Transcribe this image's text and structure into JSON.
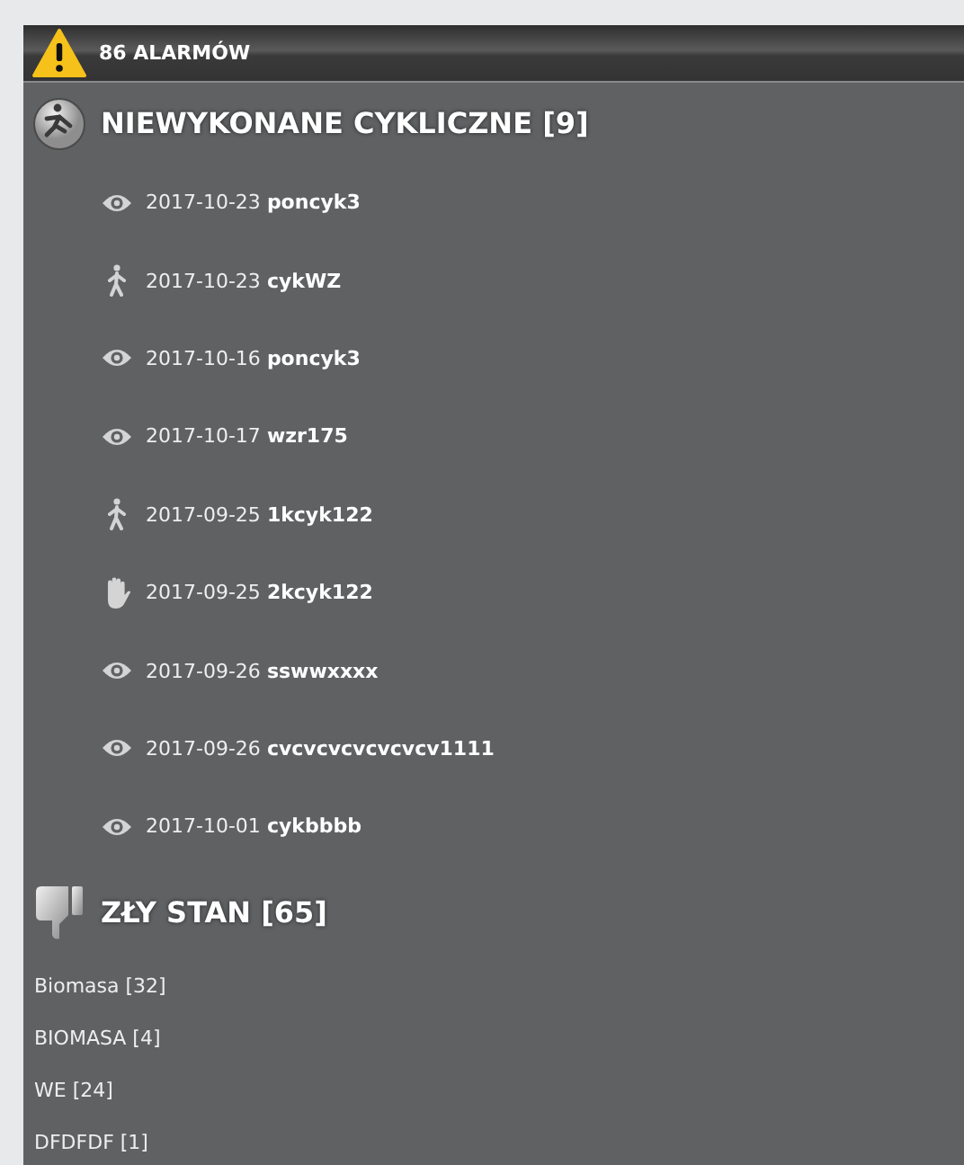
{
  "header": {
    "title": "86 ALARMÓW"
  },
  "sections": [
    {
      "kind": "cyclic",
      "title": "NIEWYKONANE CYKLICZNE [9]",
      "items": [
        {
          "kind": "eye",
          "text": "2017-10-23 **poncyk3**"
        },
        {
          "kind": "walk",
          "text": "2017-10-23 **cykWZ**"
        },
        {
          "kind": "eye",
          "text": "2017-10-16 **poncyk3**"
        },
        {
          "kind": "eye",
          "text": "2017-10-17 **wzr175**"
        },
        {
          "kind": "walk",
          "text": "2017-09-25 **1kcyk122**"
        },
        {
          "kind": "hand",
          "text": "2017-09-25 **2kcyk122**"
        },
        {
          "kind": "eye",
          "text": "2017-09-26 **sswwxxxx**"
        },
        {
          "kind": "eye",
          "text": "2017-09-26 **cvcvcvcvcvcvcv1111**"
        },
        {
          "kind": "eye",
          "text": "2017-10-01 **cykbbbb**"
        }
      ]
    },
    {
      "kind": "bad-state",
      "title": "ZŁY STAN [65]",
      "items": [
        {
          "kind": "group",
          "text": "Biomasa [32]"
        },
        {
          "kind": "group",
          "text": "BIOMASA [4]"
        },
        {
          "kind": "group",
          "text": "WE [24]"
        },
        {
          "kind": "group",
          "text": "DFDFDF [1]"
        }
      ]
    }
  ]
}
